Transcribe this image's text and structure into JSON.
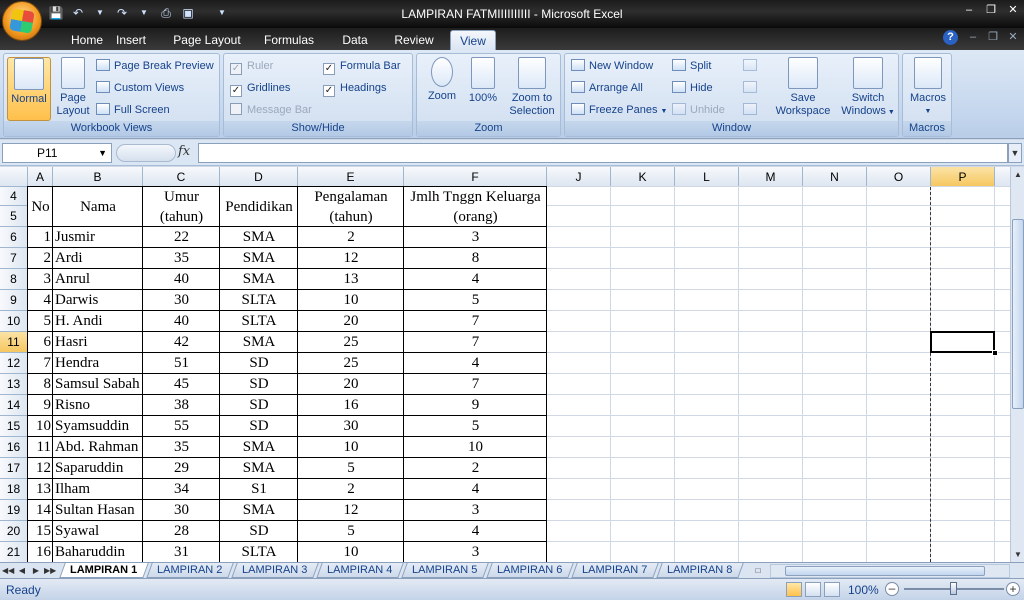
{
  "window": {
    "title": "LAMPIRAN FATMIIIIIIIIII - Microsoft Excel"
  },
  "ribbon_tabs": [
    "Home",
    "Insert",
    "Page Layout",
    "Formulas",
    "Data",
    "Review",
    "View"
  ],
  "active_tab": "View",
  "ribbon": {
    "workbook_views": {
      "label": "Workbook Views",
      "normal": "Normal",
      "page_layout": "Page Layout",
      "page_break_preview": "Page Break Preview",
      "custom_views": "Custom Views",
      "full_screen": "Full Screen"
    },
    "show_hide": {
      "label": "Show/Hide",
      "ruler": "Ruler",
      "gridlines": "Gridlines",
      "message_bar": "Message Bar",
      "formula_bar": "Formula Bar",
      "headings": "Headings"
    },
    "zoom": {
      "label": "Zoom",
      "zoom": "Zoom",
      "hundred": "100%",
      "zoom_to_selection": "Zoom to Selection"
    },
    "window": {
      "label": "Window",
      "new_window": "New Window",
      "arrange_all": "Arrange All",
      "freeze_panes": "Freeze Panes",
      "split": "Split",
      "hide": "Hide",
      "unhide": "Unhide",
      "save_workspace": "Save Workspace",
      "switch_windows": "Switch Windows"
    },
    "macros": {
      "label": "Macros",
      "macros": "Macros"
    }
  },
  "formula_bar": {
    "name_box": "P11",
    "fx": "fx",
    "value": ""
  },
  "columns": [
    "A",
    "B",
    "C",
    "D",
    "E",
    "F",
    "J",
    "K",
    "L",
    "M",
    "N",
    "O",
    "P"
  ],
  "selected_column": "P",
  "selected_row": "11",
  "rows": [
    "4",
    "5",
    "6",
    "7",
    "8",
    "9",
    "10",
    "11",
    "12",
    "13",
    "14",
    "15",
    "16",
    "17",
    "18",
    "19",
    "20",
    "21"
  ],
  "table": {
    "headers": {
      "no": "No",
      "nama": "Nama",
      "umur": [
        "Umur",
        "(tahun)"
      ],
      "pendidikan": "Pendidikan",
      "pengalaman": [
        "Pengalaman",
        "(tahun)"
      ],
      "keluarga": [
        "Jmlh Tnggn Keluarga",
        "(orang)"
      ]
    },
    "rows": [
      [
        "1",
        "Jusmir",
        "22",
        "SMA",
        "2",
        "3"
      ],
      [
        "2",
        "Ardi",
        "35",
        "SMA",
        "12",
        "8"
      ],
      [
        "3",
        "Anrul",
        "40",
        "SMA",
        "13",
        "4"
      ],
      [
        "4",
        "Darwis",
        "30",
        "SLTA",
        "10",
        "5"
      ],
      [
        "5",
        "H. Andi",
        "40",
        "SLTA",
        "20",
        "7"
      ],
      [
        "6",
        "Hasri",
        "42",
        "SMA",
        "25",
        "7"
      ],
      [
        "7",
        "Hendra",
        "51",
        "SD",
        "25",
        "4"
      ],
      [
        "8",
        "Samsul Sabah",
        "45",
        "SD",
        "20",
        "7"
      ],
      [
        "9",
        "Risno",
        "38",
        "SD",
        "16",
        "9"
      ],
      [
        "10",
        "Syamsuddin",
        "55",
        "SD",
        "30",
        "5"
      ],
      [
        "11",
        "Abd. Rahman",
        "35",
        "SMA",
        "10",
        "10"
      ],
      [
        "12",
        "Saparuddin",
        "29",
        "SMA",
        "5",
        "2"
      ],
      [
        "13",
        "Ilham",
        "34",
        "S1",
        "2",
        "4"
      ],
      [
        "14",
        "Sultan Hasan",
        "30",
        "SMA",
        "12",
        "3"
      ],
      [
        "15",
        "Syawal",
        "28",
        "SD",
        "5",
        "4"
      ],
      [
        "16",
        "Baharuddin",
        "31",
        "SLTA",
        "10",
        "3"
      ]
    ]
  },
  "sheets": [
    "LAMPIRAN 1",
    "LAMPIRAN 2",
    "LAMPIRAN 3",
    "LAMPIRAN 4",
    "LAMPIRAN 5",
    "LAMPIRAN 6",
    "LAMPIRAN 7",
    "LAMPIRAN 8"
  ],
  "active_sheet": "LAMPIRAN 1",
  "status": {
    "text": "Ready",
    "zoom": "100%",
    "zoom_fraction": 0.5
  }
}
